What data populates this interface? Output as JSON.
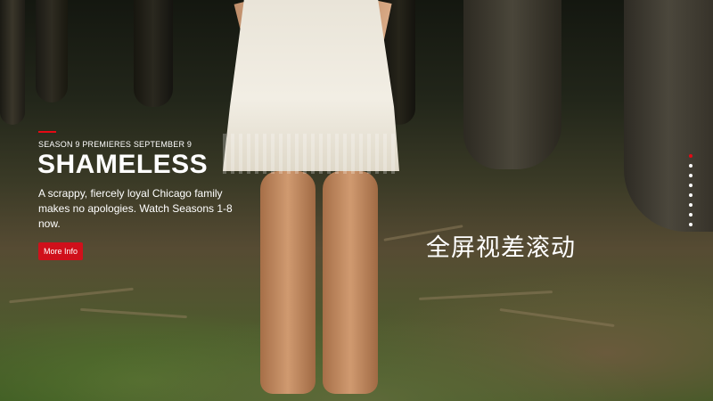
{
  "hero": {
    "eyebrow": "SEASON 9 PREMIERES SEPTEMBER 9",
    "title": "SHAMELESS",
    "description": "A scrappy, fiercely loyal Chicago family makes no apologies. Watch Seasons 1-8 now.",
    "more_button": "More Info",
    "watermark": "全屏视差滚动"
  },
  "slide_nav": {
    "count": 8,
    "active_index": 0
  },
  "colors": {
    "accent": "#e50914",
    "button_bg": "#d0101b",
    "dot_inactive": "#ffffff",
    "dot_active": "#e50914"
  }
}
